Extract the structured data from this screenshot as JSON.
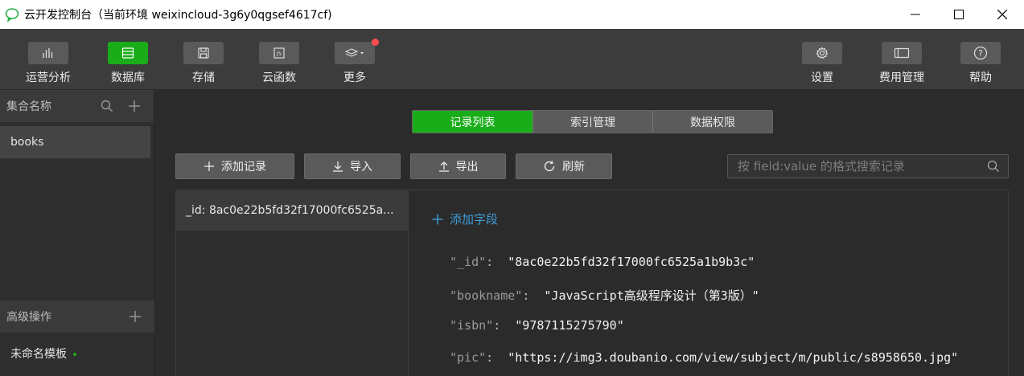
{
  "window": {
    "title": "云开发控制台（当前环境 weixincloud-3g6y0qgsef4617cf)"
  },
  "toolbar": {
    "left": [
      {
        "label": "运营分析",
        "icon": "bar-chart-icon",
        "active": false
      },
      {
        "label": "数据库",
        "icon": "database-icon",
        "active": true
      },
      {
        "label": "存储",
        "icon": "save-icon",
        "active": false
      },
      {
        "label": "云函数",
        "icon": "function-icon",
        "active": false
      },
      {
        "label": "更多",
        "icon": "layers-icon",
        "active": false
      }
    ],
    "right": [
      {
        "label": "设置",
        "icon": "gear-icon"
      },
      {
        "label": "费用管理",
        "icon": "billing-icon"
      },
      {
        "label": "帮助",
        "icon": "help-icon"
      }
    ]
  },
  "sidebar": {
    "collections_title": "集合名称",
    "collections": [
      "books"
    ],
    "advanced_title": "高级操作",
    "template_label": "未命名模板"
  },
  "tabs": [
    "记录列表",
    "索引管理",
    "数据权限"
  ],
  "actions": {
    "add": "添加记录",
    "import": "导入",
    "export": "导出",
    "refresh": "刷新"
  },
  "search": {
    "placeholder": "按 field:value 的格式搜索记录"
  },
  "records": {
    "list": [
      "_id: 8ac0e22b5fd32f17000fc6525a..."
    ],
    "add_field": "添加字段",
    "fields": [
      {
        "key": "\"_id\"",
        "value": "\"8ac0e22b5fd32f17000fc6525a1b9b3c\""
      },
      {
        "key": "\"bookname\"",
        "value": "\"JavaScript高级程序设计（第3版）\""
      },
      {
        "key": "\"isbn\"",
        "value": "\"9787115275790\""
      },
      {
        "key": "\"pic\"",
        "value": "\"https://img3.doubanio.com/view/subject/m/public/s8958650.jpg\""
      }
    ]
  },
  "colors": {
    "accent_green": "#1aad19",
    "link_blue": "#3d9ad6",
    "badge_red": "#ff4d4f"
  }
}
